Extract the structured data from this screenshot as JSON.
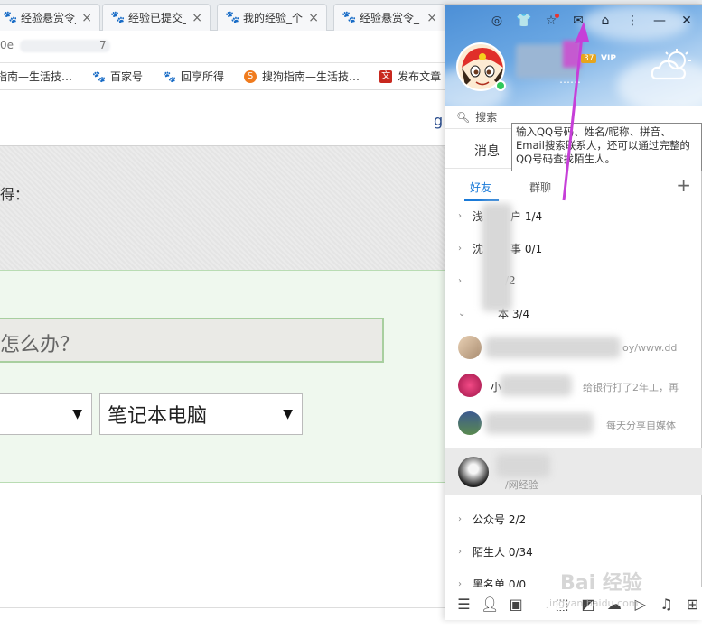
{
  "browser": {
    "tabs": [
      {
        "title": "经验悬赏令_"
      },
      {
        "title": "经验已提交_"
      },
      {
        "title": "我的经验_个"
      },
      {
        "title": "经验悬赏令_"
      }
    ],
    "url_prefix": "0e",
    "url_suffix": "7",
    "bookmarks": [
      {
        "label": "指南—生活技…",
        "icon": "paw-icon"
      },
      {
        "label": "百家号",
        "icon": "paw-icon"
      },
      {
        "label": "回享所得",
        "icon": "paw-icon"
      },
      {
        "label": "搜狗指南—生活技…",
        "icon": "sogou-icon"
      },
      {
        "label": "发布文章",
        "icon": "publish-icon"
      }
    ]
  },
  "page": {
    "corner_letter": "g",
    "gray_label": "得：",
    "question_placeholder": "怎么办？",
    "select_a_value": "",
    "select_b_value": "笔记本电脑"
  },
  "qq": {
    "level_badge": "37",
    "vip_label": "VIP",
    "signature": "……",
    "search_placeholder": "搜索",
    "tooltip": "输入QQ号码、姓名/昵称、拼音、Email搜索联系人，还可以通过完整的QQ号码查找陌生人。",
    "tab_messages": "消息",
    "tab_friends": "好友",
    "tab_groups": "群聊",
    "groups": [
      {
        "label": "浅",
        "suffix": "户 1/4"
      },
      {
        "label": "沈",
        "suffix": "事 0/1"
      },
      {
        "label": "",
        "suffix": "/2"
      },
      {
        "label": "",
        "suffix": "本 3/4"
      }
    ],
    "friends": [
      {
        "name": "",
        "sig": "oy/www.dd"
      },
      {
        "name": "小",
        "sig": "给银行打了2年工，再"
      },
      {
        "name": "",
        "sig": "每天分享自媒体"
      },
      {
        "name": "",
        "sig": "/网经验"
      }
    ],
    "bottom_groups": [
      {
        "label": "公众号 2/2"
      },
      {
        "label": "陌生人 0/34"
      },
      {
        "label": "黑名单 0/0"
      }
    ]
  },
  "watermark": {
    "text": "Bai 经验",
    "sub": "jingyan.baidu.com"
  },
  "colors": {
    "annotation_arrow": "#c63fd8",
    "accent": "#1a7ad8"
  }
}
